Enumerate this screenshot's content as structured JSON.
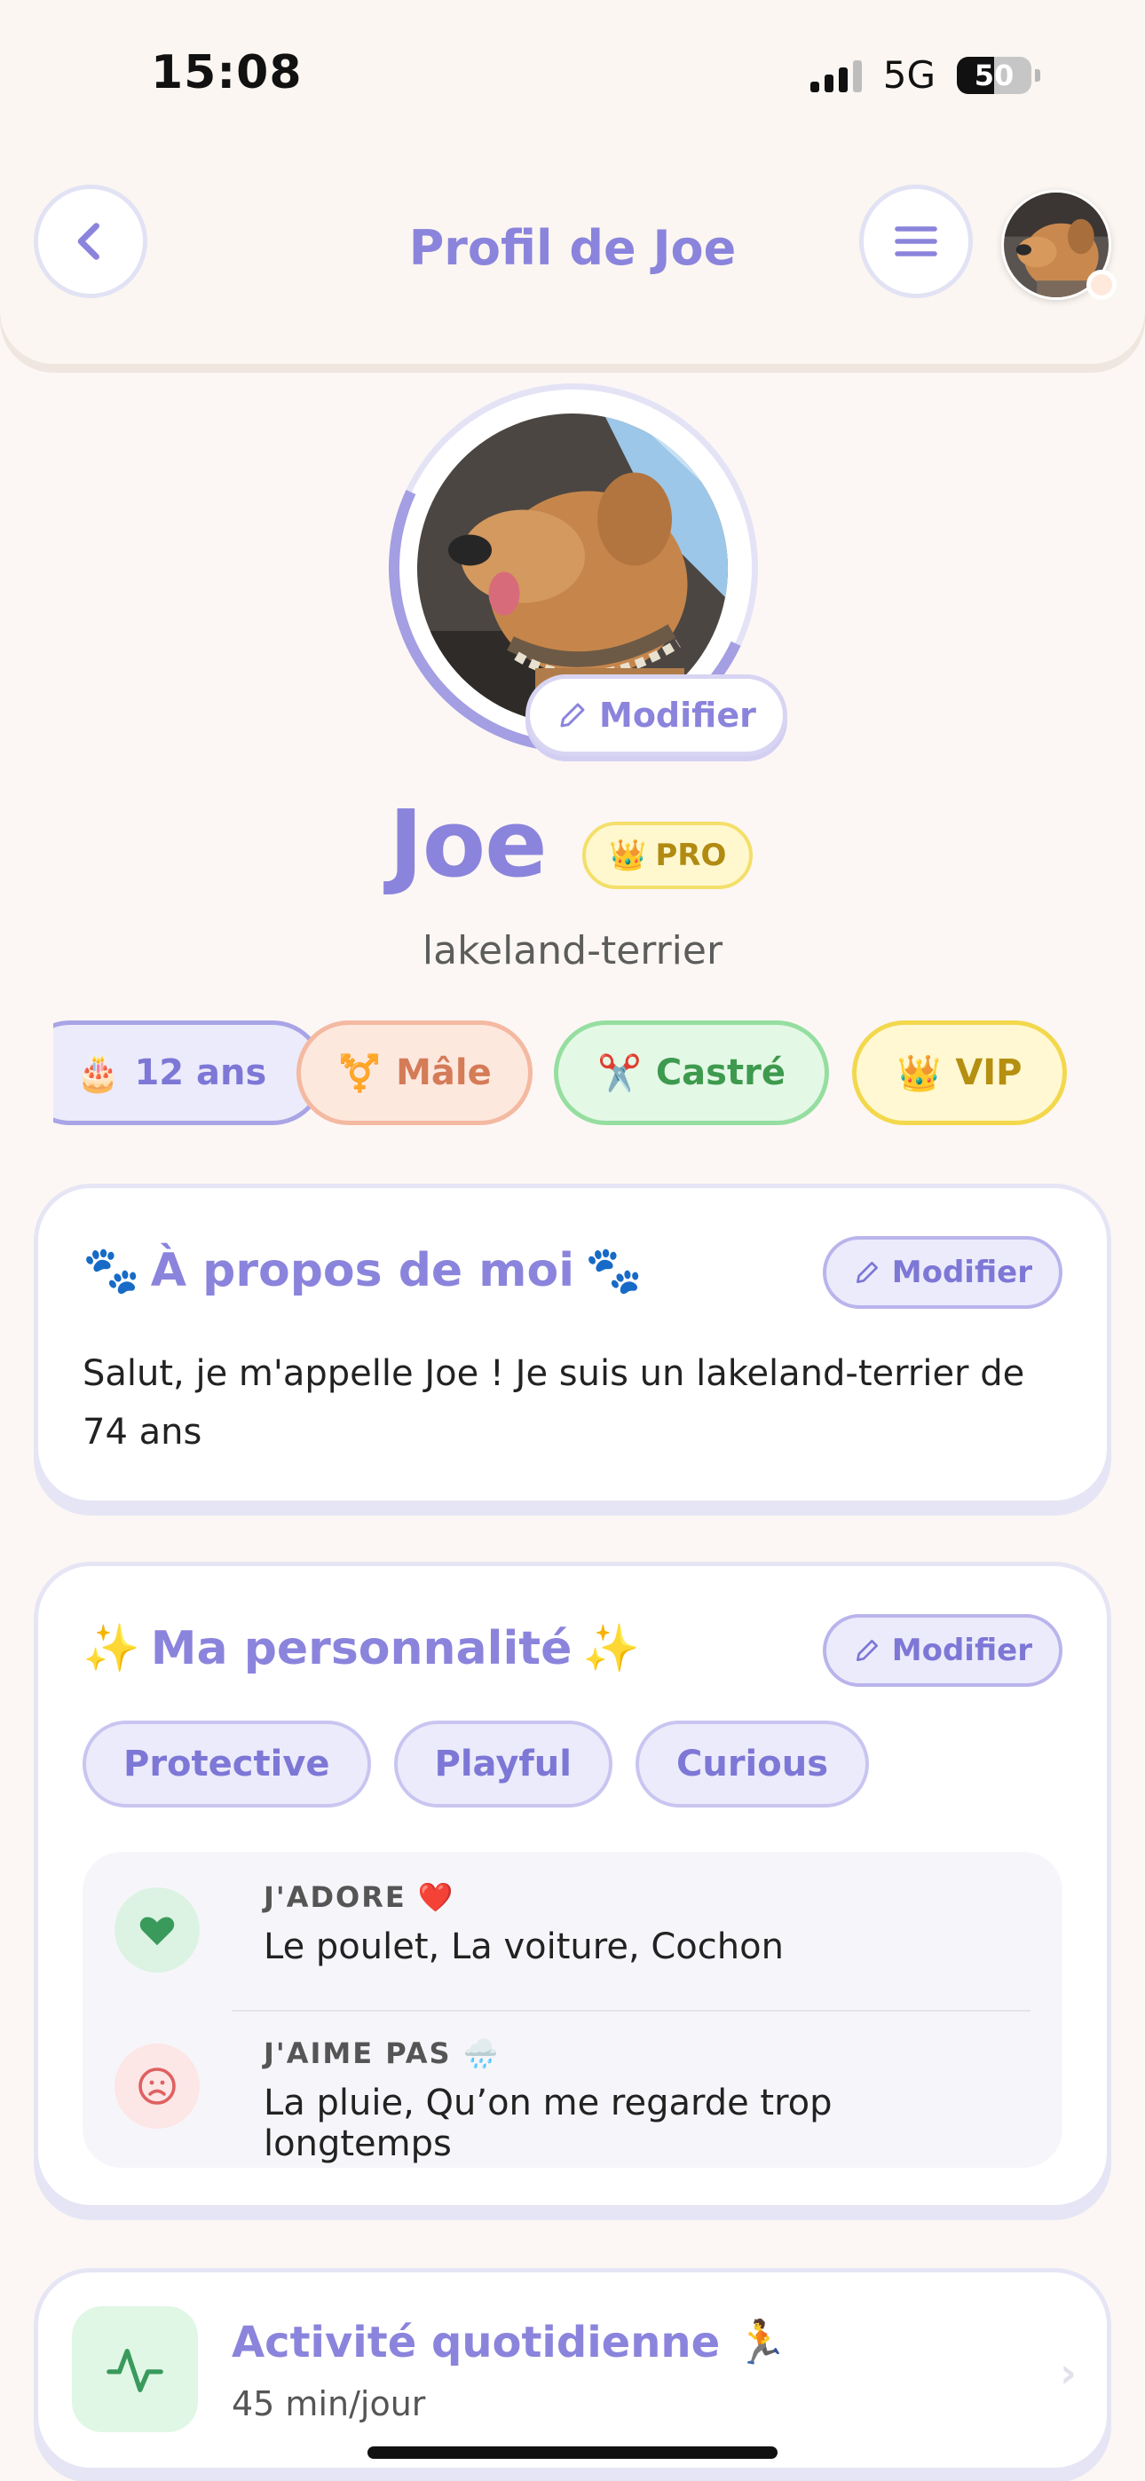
{
  "status": {
    "time": "15:08",
    "network": "5G",
    "battery": "50",
    "battery_fraction": 0.5
  },
  "header": {
    "title": "Profil de Joe"
  },
  "profile": {
    "edit_photo_label": "Modifier",
    "name": "Joe",
    "badge": "PRO",
    "breed": "lakeland-terrier"
  },
  "chips": {
    "age": {
      "emoji": "🎂",
      "label": "12 ans"
    },
    "sex": {
      "emoji": "⚧️",
      "label": "Mâle"
    },
    "neutered": {
      "emoji": "✂️",
      "label": "Castré"
    },
    "vip": {
      "emoji": "👑",
      "label": "VIP"
    }
  },
  "about": {
    "title_prefix": "🐾",
    "title": "À propos de moi",
    "title_suffix": "🐾",
    "edit_label": "Modifier",
    "text": "Salut, je m'appelle Joe ! Je suis un lakeland-terrier de 74 ans"
  },
  "personality": {
    "title_prefix": "✨",
    "title": "Ma personnalité",
    "title_suffix": "✨",
    "edit_label": "Modifier",
    "traits": [
      "Protective",
      "Playful",
      "Curious"
    ],
    "likes": {
      "label": "J'ADORE ❤️",
      "value": "Le poulet, La voiture, Cochon"
    },
    "dislikes": {
      "label": "J'AIME PAS 🌧️",
      "value": "La pluie, Qu’on me regarde trop longtemps"
    }
  },
  "activity": {
    "title": "Activité quotidienne 🏃",
    "value": "45 min/jour"
  },
  "colors": {
    "accent": "#8b84dc",
    "background": "#fcf7f4",
    "like_green": "#3a9a5c",
    "dislike_red": "#e06060"
  }
}
